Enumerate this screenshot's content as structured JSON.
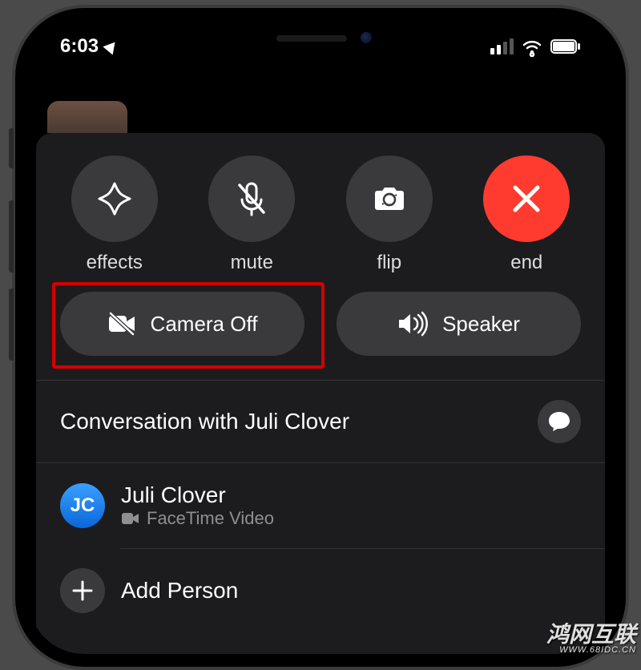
{
  "status": {
    "time": "6:03",
    "signal_bars_active": 2,
    "signal_bars_total": 4
  },
  "controls": {
    "effects": {
      "label": "effects"
    },
    "mute": {
      "label": "mute"
    },
    "flip": {
      "label": "flip"
    },
    "end": {
      "label": "end"
    },
    "camera_off": {
      "label": "Camera Off"
    },
    "speaker": {
      "label": "Speaker"
    }
  },
  "conversation": {
    "title": "Conversation with Juli Clover"
  },
  "participant": {
    "initials": "JC",
    "name": "Juli Clover",
    "subtitle": "FaceTime Video"
  },
  "add_person": {
    "label": "Add Person"
  },
  "watermark": {
    "main": "鸿网互联",
    "sub": "WWW.68IDC.CN"
  },
  "highlight": {
    "target": "camera-off-button"
  }
}
